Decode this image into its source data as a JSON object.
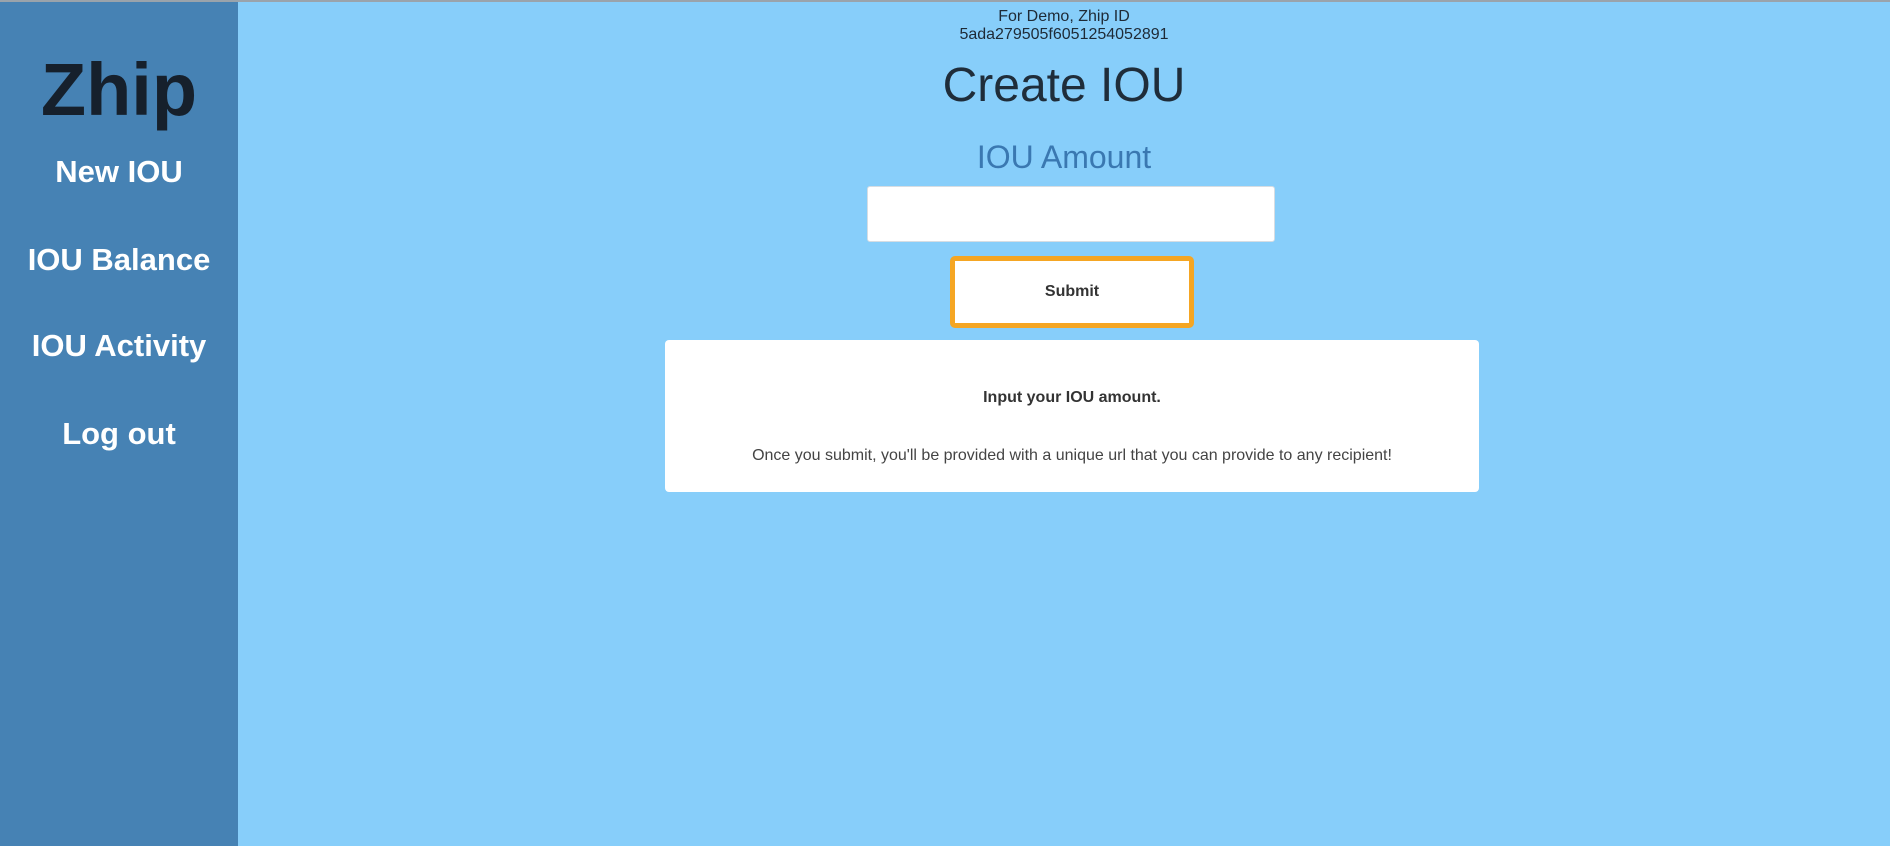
{
  "sidebar": {
    "brand": "Zhip",
    "items": [
      {
        "label": "New IOU"
      },
      {
        "label": "IOU Balance"
      },
      {
        "label": "IOU Activity"
      },
      {
        "label": "Log out"
      }
    ]
  },
  "header": {
    "demo_line1": "For Demo, Zhip ID",
    "demo_line2": "5ada279505f6051254052891"
  },
  "main": {
    "title": "Create IOU",
    "subtitle": "IOU Amount",
    "amount_input": {
      "value": "",
      "placeholder": ""
    },
    "submit_label": "Submit",
    "info": {
      "heading": "Input your IOU amount.",
      "text": "Once you submit, you'll be provided with a unique url that you can provide to any recipient!"
    }
  },
  "colors": {
    "sidebar_bg": "#4682b4",
    "main_bg": "#87cefa",
    "submit_border": "#f5a623",
    "subtitle": "#3a78b1"
  }
}
